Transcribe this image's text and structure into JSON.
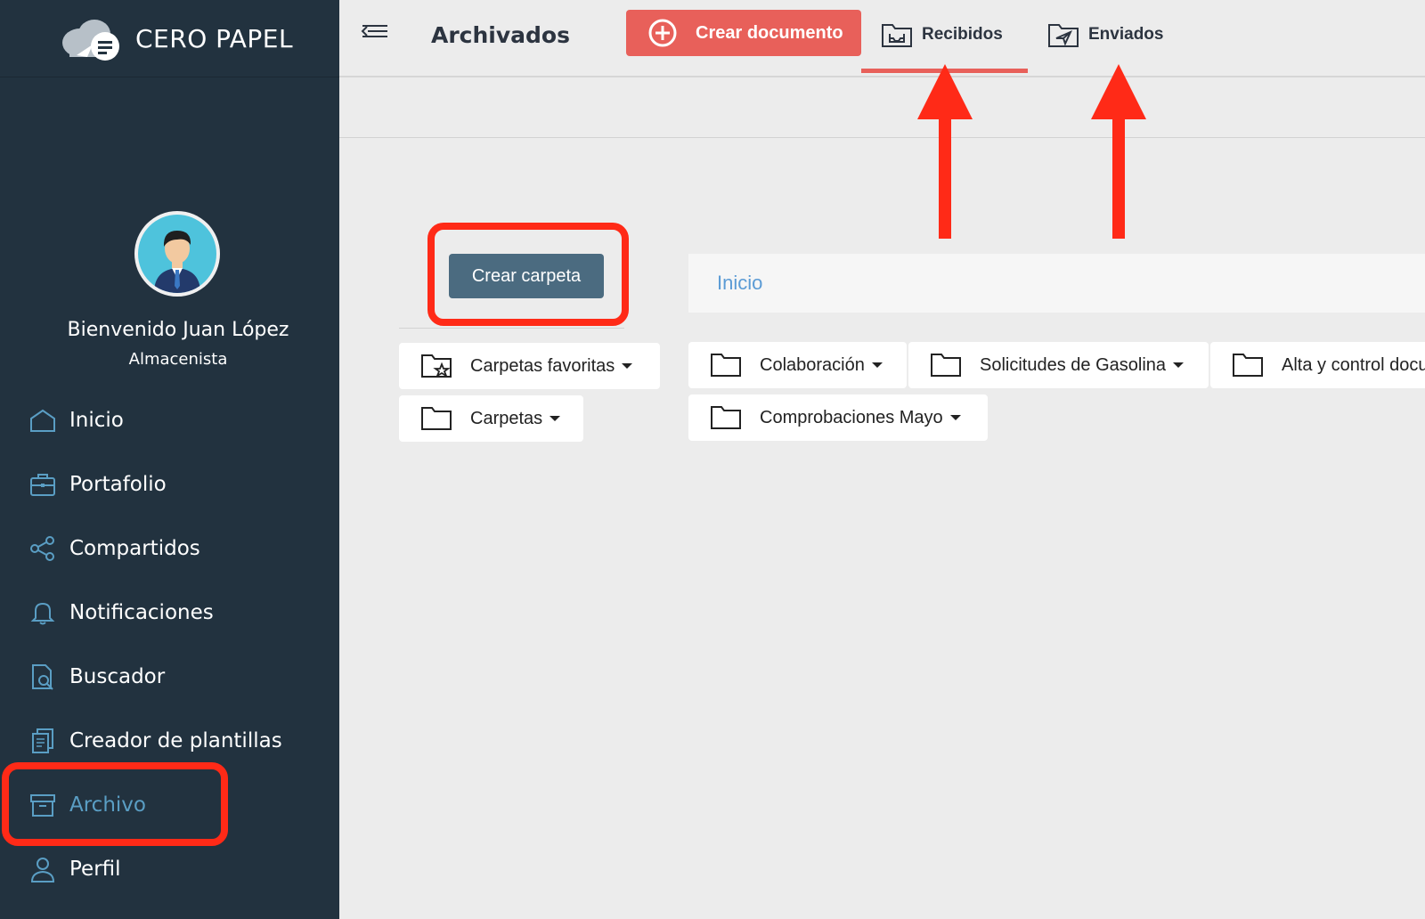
{
  "brand": {
    "name": "CERO PAPEL"
  },
  "user": {
    "welcome": "Bienvenido Juan López",
    "role": "Almacenista"
  },
  "sidebar": {
    "items": [
      {
        "label": "Inicio",
        "icon": "home-icon"
      },
      {
        "label": "Portafolio",
        "icon": "briefcase-icon"
      },
      {
        "label": "Compartidos",
        "icon": "share-icon"
      },
      {
        "label": "Notificaciones",
        "icon": "bell-icon"
      },
      {
        "label": "Buscador",
        "icon": "search-document-icon"
      },
      {
        "label": "Creador de plantillas",
        "icon": "copy-documents-icon"
      },
      {
        "label": "Archivo",
        "icon": "archive-box-icon",
        "active": true
      },
      {
        "label": "Perfil",
        "icon": "user-icon"
      }
    ]
  },
  "header": {
    "title": "Archivados",
    "create_document": "Crear documento",
    "tabs": [
      {
        "label": "Recibidos",
        "icon": "inbox-folder-icon",
        "active": true
      },
      {
        "label": "Enviados",
        "icon": "sent-folder-icon"
      }
    ]
  },
  "main": {
    "create_folder": "Crear carpeta",
    "breadcrumb": "Inicio",
    "folders_left": [
      {
        "label": "Carpetas favoritas",
        "icon": "star-folder-icon"
      },
      {
        "label": "Carpetas",
        "icon": "folder-icon"
      }
    ],
    "folders_right": [
      {
        "label": "Colaboración"
      },
      {
        "label": "Solicitudes de Gasolina"
      },
      {
        "label": "Alta y control docu"
      },
      {
        "label": "Comprobaciones Mayo"
      }
    ]
  },
  "colors": {
    "sidebar": "#22323f",
    "accent": "#e8605a",
    "folder_button": "#4b6b80",
    "link": "#5b9bd5",
    "annotation": "#ff2a17"
  }
}
